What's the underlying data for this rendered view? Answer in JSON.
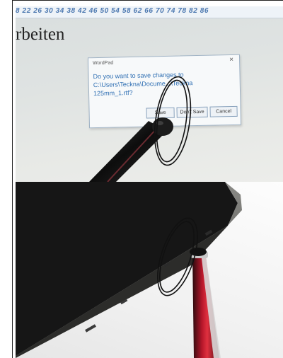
{
  "top_photo": {
    "ruler_numbers": "8 22 26 30 34 38 42 46 50 54 58 62 66 70 74 78 82 86",
    "document_text": "rbeiten",
    "dialog": {
      "title": "WordPad",
      "close_symbol": "×",
      "message_lines": [
        "Do you want to save changes to",
        "C:\\Users\\Teckna\\Docume...\\Teckna",
        "125mm_1.rtf?"
      ],
      "buttons": {
        "save": "Save",
        "dont_save": "Don't Save",
        "cancel": "Cancel"
      }
    }
  },
  "colors": {
    "screen_background": "#e2e5e3",
    "ruler_text": "#4c78b0",
    "dialog_text": "#2f6fb3",
    "stylus_tip": "#1c1c1c",
    "stylus_red": "#b5162a",
    "tablet_body": "#161616"
  },
  "icons": [
    "stylus-pen",
    "highlight-ellipse"
  ]
}
